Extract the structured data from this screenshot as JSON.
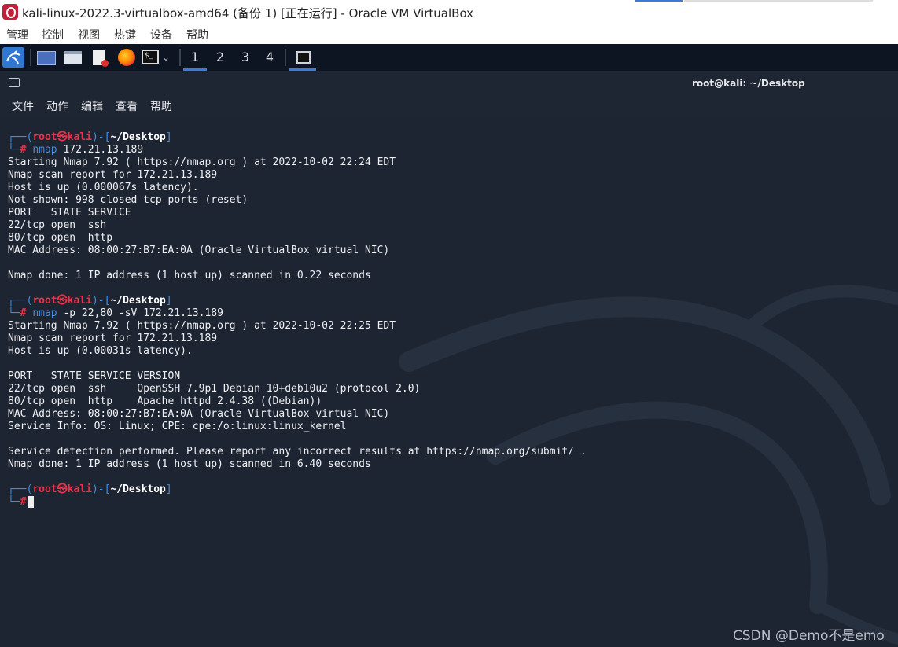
{
  "window": {
    "title": "kali-linux-2022.3-virtualbox-amd64 (备份 1) [正在运行] - Oracle VM VirtualBox",
    "menu": [
      "管理",
      "控制",
      "视图",
      "热键",
      "设备",
      "帮助"
    ]
  },
  "panel": {
    "workspaces": [
      "1",
      "2",
      "3",
      "4"
    ],
    "active_workspace": "1"
  },
  "terminal": {
    "title": "root@kali: ~/Desktop",
    "menu": [
      "文件",
      "动作",
      "编辑",
      "查看",
      "帮助"
    ],
    "prompt": {
      "top_left": "┌──(",
      "user": "root",
      "at": "㉿",
      "host": "kali",
      "mid": ")-[",
      "path": "~/Desktop",
      "end": "]",
      "bottom_left": "└─",
      "hash": "#"
    },
    "cmd1": {
      "name": "nmap",
      "args": " 172.21.13.189"
    },
    "output1": [
      "Starting Nmap 7.92 ( https://nmap.org ) at 2022-10-02 22:24 EDT",
      "Nmap scan report for 172.21.13.189",
      "Host is up (0.000067s latency).",
      "Not shown: 998 closed tcp ports (reset)",
      "PORT   STATE SERVICE",
      "22/tcp open  ssh",
      "80/tcp open  http",
      "MAC Address: 08:00:27:B7:EA:0A (Oracle VirtualBox virtual NIC)",
      "",
      "Nmap done: 1 IP address (1 host up) scanned in 0.22 seconds",
      ""
    ],
    "cmd2": {
      "name": "nmap",
      "args": " -p 22,80 -sV 172.21.13.189"
    },
    "output2": [
      "Starting Nmap 7.92 ( https://nmap.org ) at 2022-10-02 22:25 EDT",
      "Nmap scan report for 172.21.13.189",
      "Host is up (0.00031s latency).",
      "",
      "PORT   STATE SERVICE VERSION",
      "22/tcp open  ssh     OpenSSH 7.9p1 Debian 10+deb10u2 (protocol 2.0)",
      "80/tcp open  http    Apache httpd 2.4.38 ((Debian))",
      "MAC Address: 08:00:27:B7:EA:0A (Oracle VirtualBox virtual NIC)",
      "Service Info: OS: Linux; CPE: cpe:/o:linux:linux_kernel",
      "",
      "Service detection performed. Please report any incorrect results at https://nmap.org/submit/ .",
      "Nmap done: 1 IP address (1 host up) scanned in 6.40 seconds",
      ""
    ]
  },
  "watermark": "CSDN @Demo不是emo"
}
